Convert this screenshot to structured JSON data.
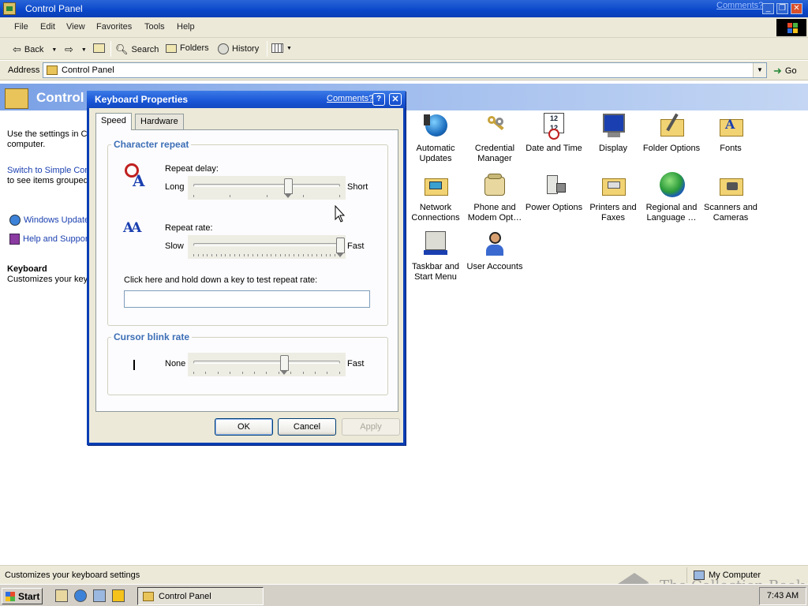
{
  "window": {
    "title": "Control Panel",
    "comments_link": "Comments?",
    "minimize": "_",
    "restore": "❐",
    "close": "✕"
  },
  "menu": [
    "File",
    "Edit",
    "View",
    "Favorites",
    "Tools",
    "Help"
  ],
  "toolbar": {
    "back": "Back",
    "search": "Search",
    "folders": "Folders",
    "history": "History"
  },
  "address": {
    "label": "Address",
    "value": "Control Panel",
    "go": "Go"
  },
  "header": {
    "title": "Control"
  },
  "left_pane": {
    "description": "Use the settings in Control Panel to personalize your computer.",
    "switch_link": "Switch to Simple Control Panel",
    "switch_text": "to see items grouped by categories.",
    "links": [
      "Windows Update",
      "Help and Support"
    ],
    "selected_title": "Keyboard",
    "selected_desc": "Customizes your keyboard settings"
  },
  "icons": [
    {
      "label": "Automatic Updates",
      "icon": "globe-update-icon"
    },
    {
      "label": "Credential Manager",
      "icon": "keys-icon"
    },
    {
      "label": "Date and Time",
      "icon": "calendar-clock-icon"
    },
    {
      "label": "Display",
      "icon": "monitor-icon"
    },
    {
      "label": "Folder Options",
      "icon": "folder-tools-icon"
    },
    {
      "label": "Fonts",
      "icon": "fonts-folder-icon"
    },
    {
      "label": "Network Connections",
      "icon": "network-icon"
    },
    {
      "label": "Phone and Modem Opt…",
      "icon": "phone-icon"
    },
    {
      "label": "Power Options",
      "icon": "power-plug-icon"
    },
    {
      "label": "Printers and Faxes",
      "icon": "printer-folder-icon"
    },
    {
      "label": "Regional and Language …",
      "icon": "globe-icon"
    },
    {
      "label": "Scanners and Cameras",
      "icon": "camera-folder-icon"
    },
    {
      "label": "Taskbar and Start Menu",
      "icon": "taskbar-icon"
    },
    {
      "label": "User Accounts",
      "icon": "user-icon"
    }
  ],
  "dialog": {
    "title": "Keyboard Properties",
    "comments": "Comments?",
    "help": "?",
    "close": "✕",
    "tabs": [
      "Speed",
      "Hardware"
    ],
    "character_repeat": {
      "label": "Character repeat",
      "repeat_delay": {
        "label": "Repeat delay:",
        "min": "Long",
        "max": "Short",
        "value": 0.65,
        "ticks": 4
      },
      "repeat_rate": {
        "label": "Repeat rate:",
        "min": "Slow",
        "max": "Fast",
        "value": 1.0,
        "ticks": 32
      },
      "test_label": "Click here and hold down a key to test repeat rate:"
    },
    "cursor_blink": {
      "label": "Cursor blink rate",
      "min": "None",
      "max": "Fast",
      "value": 0.62,
      "ticks": 12
    },
    "buttons": {
      "ok": "OK",
      "cancel": "Cancel",
      "apply": "Apply"
    }
  },
  "status": {
    "text": "Customizes your keyboard settings",
    "zone": "My Computer"
  },
  "taskbar": {
    "start": "Start",
    "task": "Control Panel",
    "clock": "7:43 AM"
  },
  "watermark": "The Collection Book"
}
